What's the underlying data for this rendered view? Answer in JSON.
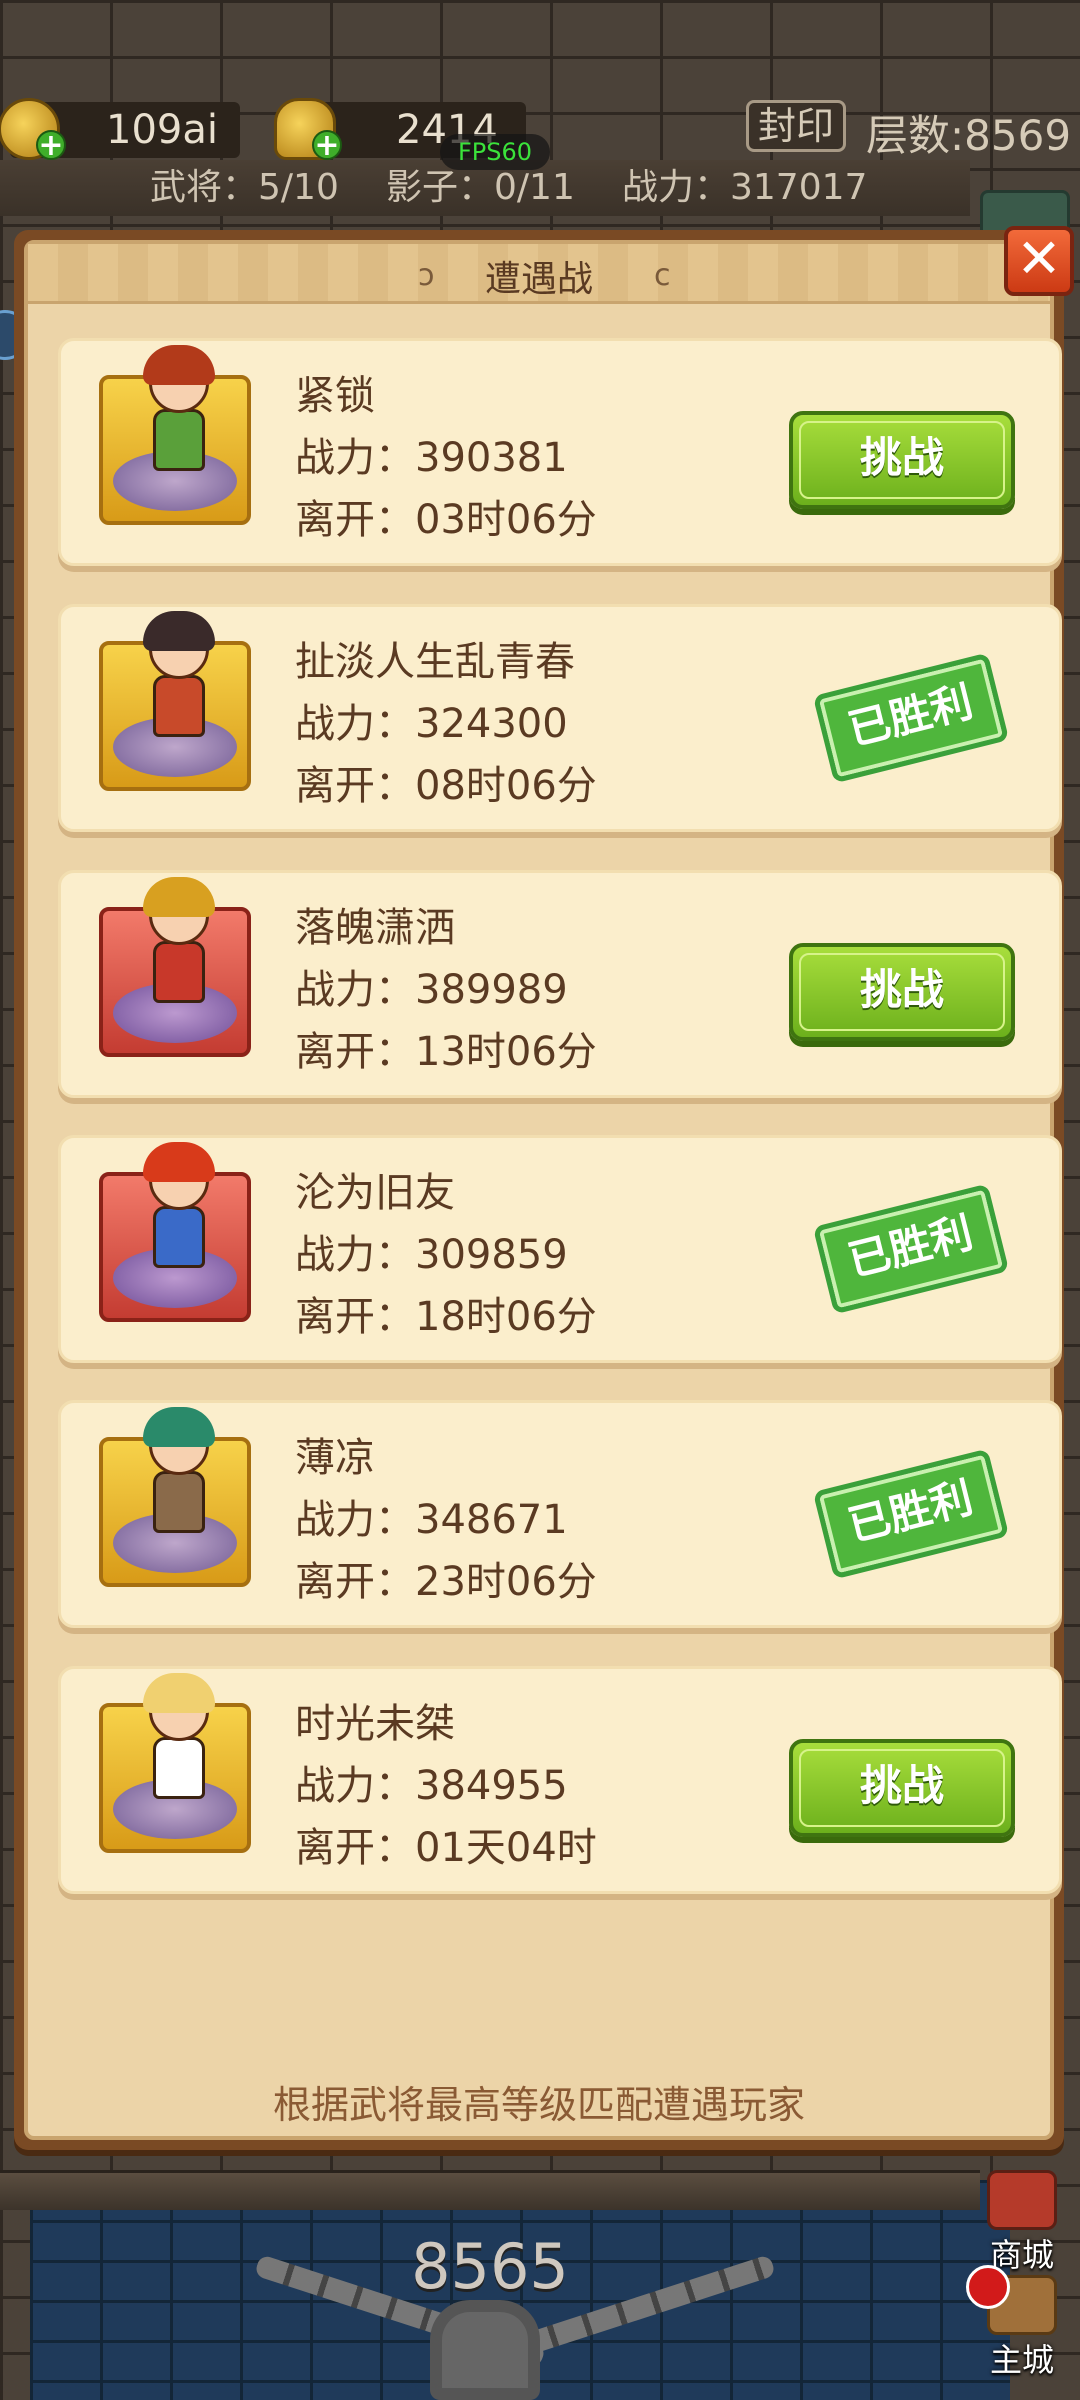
{
  "top": {
    "gold_value": "109ai",
    "ingot_value": "2414",
    "fps_label": "FPS60",
    "seal_label": "封印",
    "floor_label": "层数:8569",
    "generals_label": "武将：5/10",
    "shadow_label": "影子：0/11",
    "power_label": "战力：317017"
  },
  "dialog": {
    "title": "遭遇战",
    "close_label": "✕",
    "footer_tip": "根据武将最高等级匹配遭遇玩家",
    "entries": [
      {
        "name": "紧锁",
        "power": "战力：390381",
        "leave": "离开：03时06分",
        "status": "challenge",
        "action_label": "挑战",
        "frame": "gold"
      },
      {
        "name": "扯淡人生乱青春",
        "power": "战力：324300",
        "leave": "离开：08时06分",
        "status": "won",
        "action_label": "已胜利",
        "frame": "gold"
      },
      {
        "name": "落魄潇洒",
        "power": "战力：389989",
        "leave": "离开：13时06分",
        "status": "challenge",
        "action_label": "挑战",
        "frame": "red"
      },
      {
        "name": "沦为旧友",
        "power": "战力：309859",
        "leave": "离开：18时06分",
        "status": "won",
        "action_label": "已胜利",
        "frame": "red"
      },
      {
        "name": "薄凉",
        "power": "战力：348671",
        "leave": "离开：23时06分",
        "status": "won",
        "action_label": "已胜利",
        "frame": "gold"
      },
      {
        "name": "时光未桀",
        "power": "战力：384955",
        "leave": "离开：01天04时",
        "status": "challenge",
        "action_label": "挑战",
        "frame": "gold"
      }
    ]
  },
  "background": {
    "floor_number": "8565",
    "shop_label": "商城",
    "home_label": "主城"
  }
}
